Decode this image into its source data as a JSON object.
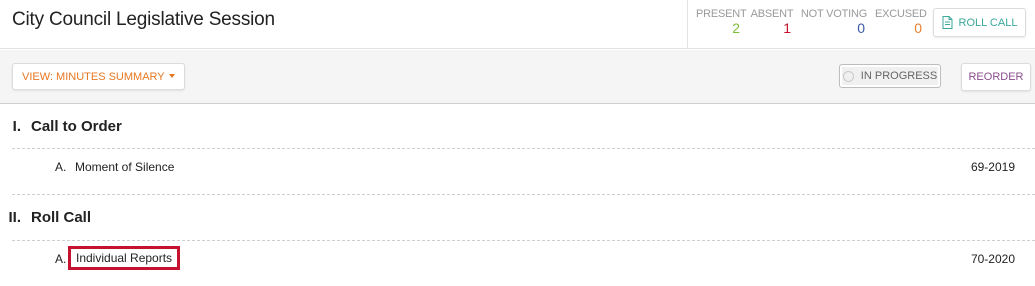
{
  "header": {
    "title": "City Council Legislative Session"
  },
  "attendance": {
    "present_label": "PRESENT",
    "present_count": "2",
    "absent_label": "ABSENT",
    "absent_count": "1",
    "not_voting_label": "NOT VOTING",
    "not_voting_count": "0",
    "excused_label": "EXCUSED",
    "excused_count": "0",
    "present_color": "#7bbf3a",
    "absent_color": "#c8102e",
    "not_voting_color": "#3a5aa8",
    "excused_color": "#e8802f"
  },
  "toolbar": {
    "roll_call_label": "ROLL CALL",
    "roll_call_icon": "document-icon",
    "view_label": "VIEW: MINUTES SUMMARY",
    "status_label": "IN PROGRESS",
    "reorder_label": "REORDER"
  },
  "agenda": {
    "sections": [
      {
        "numeral": "I.",
        "title": "Call to Order",
        "items": [
          {
            "letter": "A.",
            "name": "Moment of Silence",
            "code": "69-2019"
          }
        ]
      },
      {
        "numeral": "II.",
        "title": "Roll Call",
        "items": [
          {
            "letter": "A.",
            "name": "Individual Reports",
            "code": "70-2020"
          }
        ]
      }
    ]
  },
  "accent": {
    "highlight_border": "#c41230",
    "view_color": "#e87722",
    "roll_call_color": "#3aa89a",
    "reorder_color": "#8a4d8c"
  }
}
